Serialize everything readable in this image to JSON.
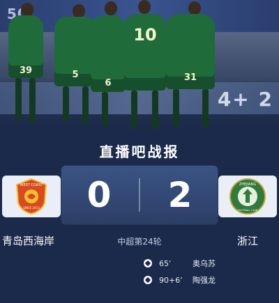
{
  "header": {
    "title": "直播吧战报"
  },
  "hero": {
    "banner_text": "50",
    "board_text": "4+ 2",
    "shirt_numbers": [
      "39",
      "5",
      "6",
      "10",
      "31"
    ]
  },
  "match": {
    "home": {
      "name": "青岛西海岸",
      "score": "0",
      "badge_top": "WEST COAST",
      "badge_bottom": "SINCE 2013"
    },
    "away": {
      "name": "浙江",
      "score": "2",
      "badge_top": "ZHEJIANG",
      "badge_bottom": "FOOTBALL CLUB"
    },
    "round": "中超第24轮"
  },
  "goals": [
    {
      "minute": "65’",
      "scorer": "奥乌苏"
    },
    {
      "minute": "90+6’",
      "scorer": "陶强龙"
    }
  ],
  "colors": {
    "background": "#1b2a4a",
    "scorecard": "#2b3f66",
    "home_badge": "#d94a1f",
    "away_badge": "#2f7a3c"
  }
}
